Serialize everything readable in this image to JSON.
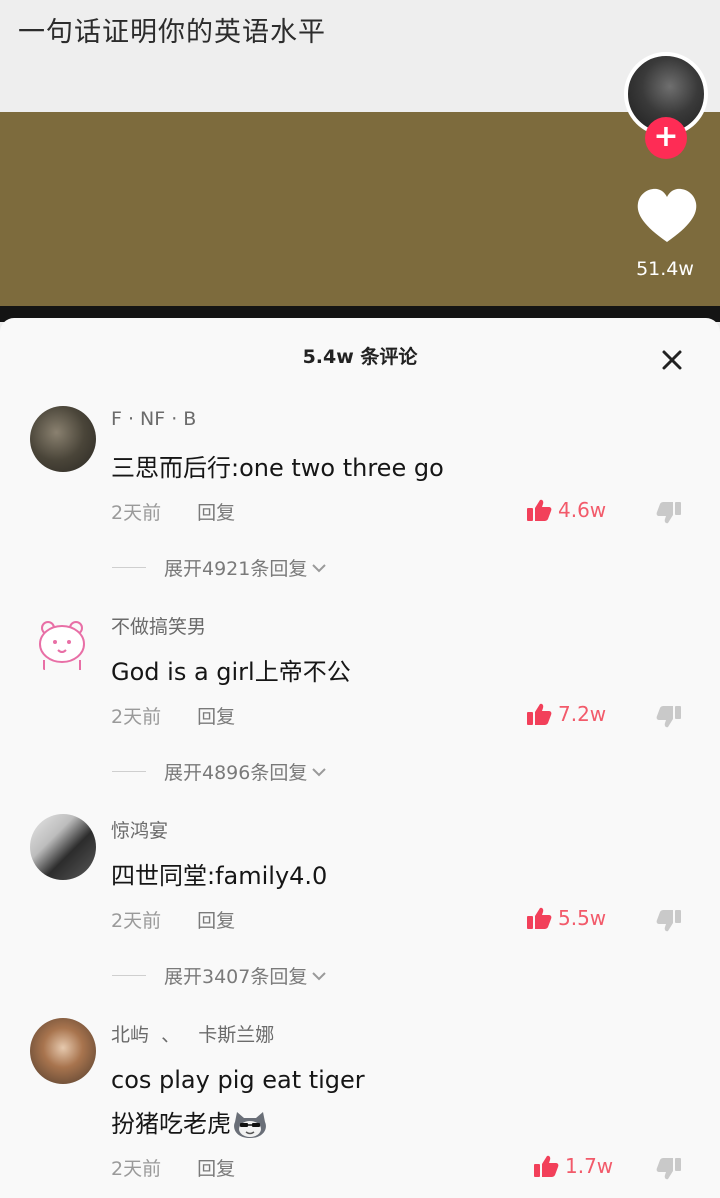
{
  "video": {
    "title": "一句话证明你的英语水平",
    "like_count": "51.4w",
    "follow_symbol": "+"
  },
  "colors": {
    "accent": "#fe2c55",
    "like_red": "#f25a6a",
    "video_bg": "#7d6b3d"
  },
  "icons": [
    "heart-icon",
    "close-icon",
    "thumbs-up-icon",
    "thumbs-down-icon",
    "chevron-down-icon"
  ],
  "sheet": {
    "title": "5.4w 条评论"
  },
  "comments": [
    {
      "username": "F · NF · B",
      "text": "三思而后行:one two three go",
      "time": "2天前",
      "reply": "回复",
      "likes": "4.6w",
      "expand": "展开4921条回复"
    },
    {
      "username": "不做搞笑男",
      "text": "God is a girl上帝不公",
      "time": "2天前",
      "reply": "回复",
      "likes": "7.2w",
      "expand": "展开4896条回复"
    },
    {
      "username": "惊鸿宴",
      "text": "四世同堂:family4.0",
      "time": "2天前",
      "reply": "回复",
      "likes": "5.5w",
      "expand": "展开3407条回复"
    },
    {
      "username": "北屿  、   卡斯兰娜",
      "text_line1": "cos play pig eat tiger",
      "text_line2": "扮猪吃老虎",
      "time": "2天前",
      "reply": "回复",
      "likes": "1.7w"
    }
  ]
}
